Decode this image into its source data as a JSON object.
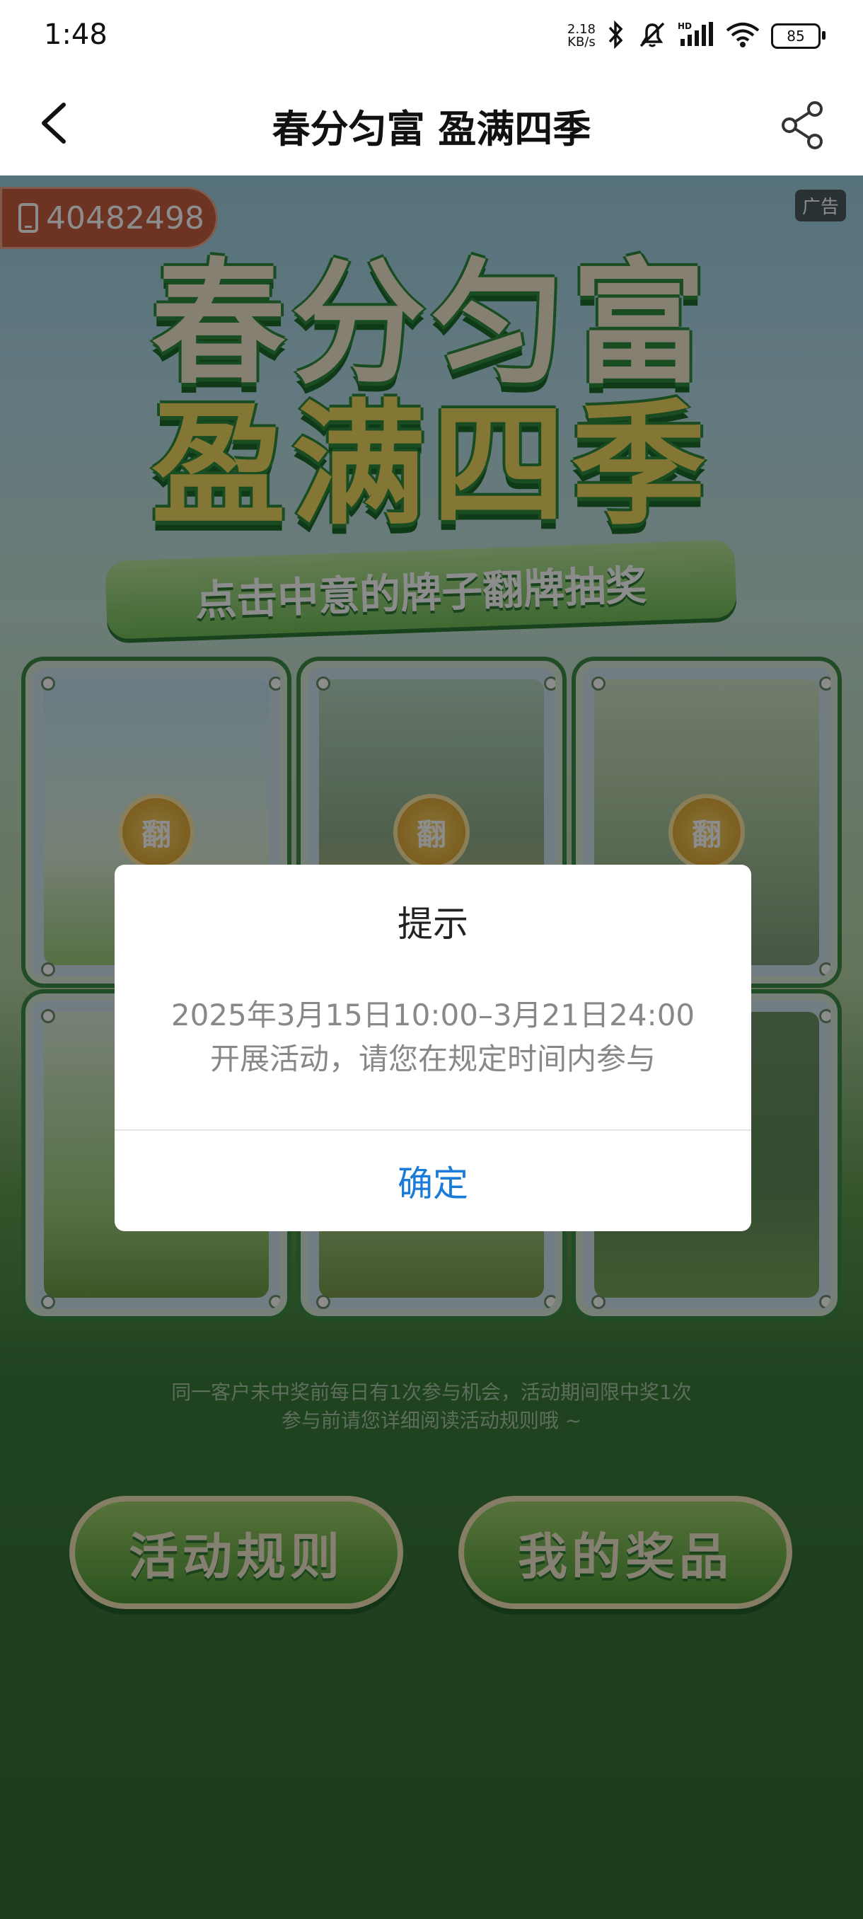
{
  "status_bar": {
    "time": "1:48",
    "net_speed_value": "2.18",
    "net_speed_unit": "KB/s",
    "battery": "85"
  },
  "nav": {
    "title": "春分匀富 盈满四季"
  },
  "banner": {
    "phone": "40482498",
    "ad_tag": "广告",
    "hero_line1": "春分匀富",
    "hero_line2": "盈满四季",
    "ribbon": "点击中意的牌子翻牌抽奖"
  },
  "cards": {
    "flip_label": "翻"
  },
  "notice": {
    "line1": "同一客户未中奖前每日有1次参与机会，活动期间限中奖1次",
    "line2": "参与前请您详细阅读活动规则哦 ~"
  },
  "buttons": {
    "rules": "活动规则",
    "prizes": "我的奖品"
  },
  "dialog": {
    "title": "提示",
    "message_line1": "2025年3月15日10:00–3月21日24:00",
    "message_line2": "开展活动，请您在规定时间内参与",
    "confirm": "确定"
  },
  "colors": {
    "accent_link": "#1a7bd8",
    "page_green": "#3a7a3a",
    "badge_orange": "#c76040"
  }
}
